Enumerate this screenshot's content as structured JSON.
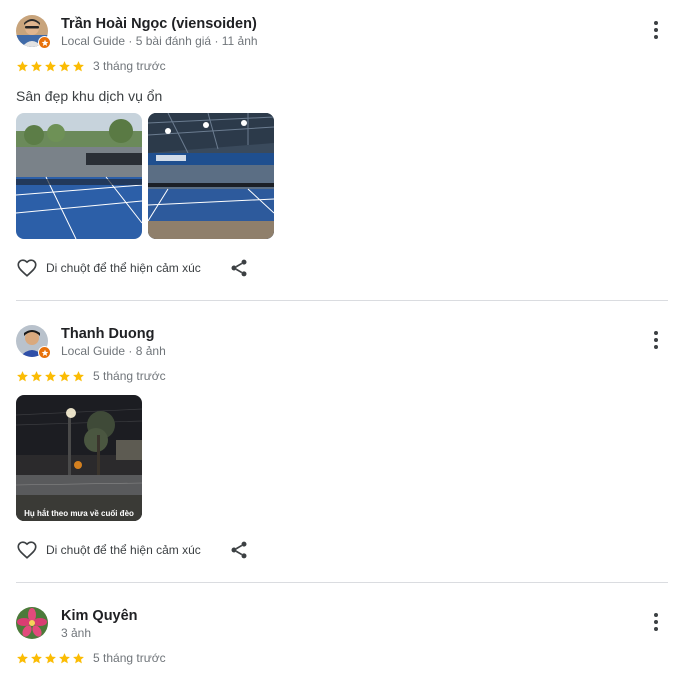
{
  "reviews": [
    {
      "name": "Trần Hoài Ngọc (viensoiden)",
      "meta": "Local Guide · 5 bài đánh giá · 11 ảnh",
      "rating": 5,
      "when": "3 tháng trước",
      "text": "Sân đẹp khu dịch vụ ổn",
      "photo_count": 2,
      "local_guide": true
    },
    {
      "name": "Thanh Duong",
      "meta": "Local Guide · 8 ảnh",
      "rating": 5,
      "when": "5 tháng trước",
      "photo_caption": "Hụ hắt theo mưa về cuối đèo",
      "photo_count": 1,
      "local_guide": true
    },
    {
      "name": "Kim Quyên",
      "meta": "3 ảnh",
      "rating": 5,
      "when": "5 tháng trước",
      "local_guide": false
    }
  ],
  "actions": {
    "react_label": "Di chuột để thể hiện cảm xúc"
  },
  "icons": {
    "more": "more-vert-icon",
    "heart": "heart-outline-icon",
    "share": "share-icon",
    "star": "star-icon",
    "badge": "local-guide-badge-icon"
  },
  "colors": {
    "star": "#fbbc04",
    "badge": "#e8710a",
    "meta_text": "#70757a",
    "divider": "#dadce0"
  }
}
